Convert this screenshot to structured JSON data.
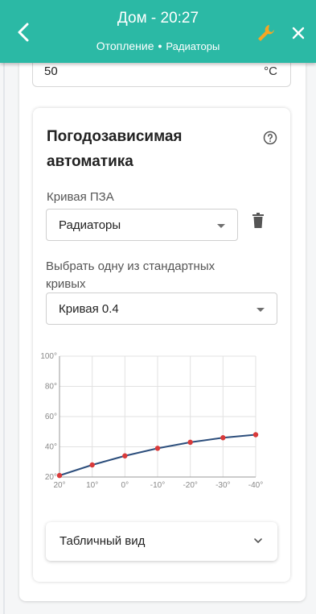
{
  "header": {
    "title": "Дом - 20:27",
    "breadcrumb_parent": "Отопление",
    "breadcrumb_separator": "•",
    "breadcrumb_current": "Радиаторы",
    "accent_color": "#2bb9a5",
    "icons": [
      "back-arrow",
      "wrench",
      "close"
    ]
  },
  "temperature_field": {
    "value": "50",
    "unit": "°C"
  },
  "weather_automation": {
    "title": "Погодозависимая автоматика",
    "curve_label": "Кривая ПЗА",
    "curve_value": "Радиаторы",
    "standard_label": "Выбрать одну из стандартных кривых",
    "standard_value": "Кривая 0.4",
    "table_view_label": "Табличный вид"
  },
  "chart_data": {
    "type": "line",
    "x": [
      "20°",
      "10°",
      "0°",
      "-10°",
      "-20°",
      "-30°",
      "-40°"
    ],
    "y_ticks": [
      "20°",
      "40°",
      "60°",
      "80°",
      "100°"
    ],
    "ylim": [
      20,
      100
    ],
    "series": [
      {
        "values": [
          21,
          28,
          34,
          39,
          43,
          46,
          48
        ],
        "color": "#2c4e7c",
        "point_color": "#d93a3a"
      }
    ],
    "grid": true
  }
}
